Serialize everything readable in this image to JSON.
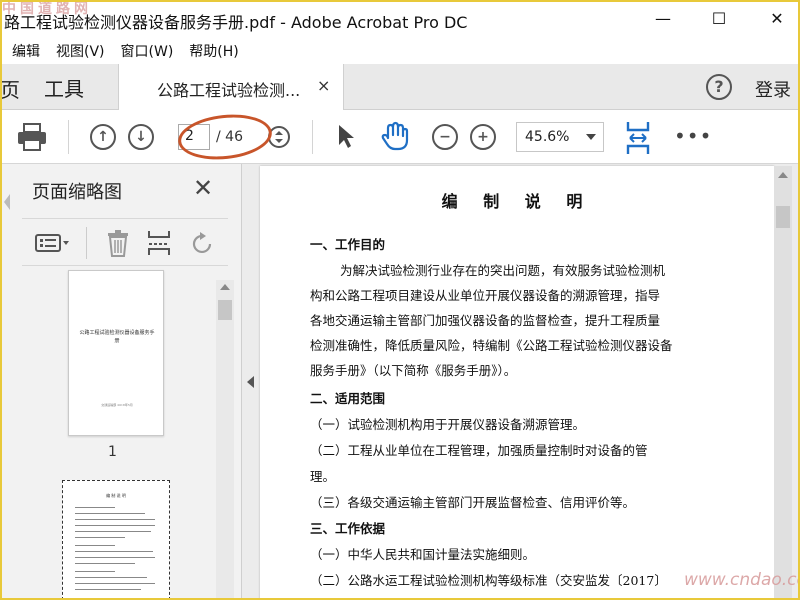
{
  "window": {
    "title": "路工程试验检测仪器设备服务手册.pdf - Adobe Acrobat Pro DC",
    "watermark_top": "中国道路网",
    "minimize": "—",
    "maximize": "☐",
    "close": "✕"
  },
  "menu": [
    "编辑",
    "视图(V)",
    "窗口(W)",
    "帮助(H)"
  ],
  "tabs": {
    "home_partial": "页",
    "tools": "工具",
    "document": "公路工程试验检测...",
    "close": "×",
    "help": "?",
    "login": "登录"
  },
  "toolbar": {
    "current_page": "2",
    "total_pages": "/ 46",
    "zoom": "45.6%",
    "more": "•••"
  },
  "sidepanel": {
    "title": "页面缩略图",
    "close": "✕",
    "thumb1_title": "公路工程试验检测仪器设备服务手册",
    "thumb1_footer": "交通运输部 2018年5月",
    "thumb1_number": "1",
    "thumb2_title": "编 制 说 明"
  },
  "document": {
    "title": "编 制 说 明",
    "lines": [
      {
        "text": "一、工作目的",
        "bold": true,
        "indent": false
      },
      {
        "text": "为解决试验检测行业存在的突出问题，有效服务试验检测机",
        "bold": false,
        "indent": true
      },
      {
        "text": "构和公路工程项目建设从业单位开展仪器设备的溯源管理，指导",
        "bold": false,
        "indent": false
      },
      {
        "text": "各地交通运输主管部门加强仪器设备的监督检查，提升工程质量",
        "bold": false,
        "indent": false
      },
      {
        "text": "检测准确性，降低质量风险，特编制《公路工程试验检测仪器设备",
        "bold": false,
        "indent": false
      },
      {
        "text": "服务手册》（以下简称《服务手册》）。",
        "bold": false,
        "indent": false
      },
      {
        "text": "二、适用范围",
        "bold": true,
        "indent": false
      },
      {
        "text": "（一）试验检测机构用于开展仪器设备溯源管理。",
        "bold": false,
        "indent": false
      },
      {
        "text": "（二）工程从业单位在工程管理，加强质量控制时对设备的管",
        "bold": false,
        "indent": false
      },
      {
        "text": "理。",
        "bold": false,
        "indent": false
      },
      {
        "text": "（三）各级交通运输主管部门开展监督检查、信用评价等。",
        "bold": false,
        "indent": false
      },
      {
        "text": "三、工作依据",
        "bold": true,
        "indent": false
      },
      {
        "text": "（一）中华人民共和国计量法实施细则。",
        "bold": false,
        "indent": false
      },
      {
        "text": "（二）公路水运工程试验检测机构等级标准（交安监发〔2017〕",
        "bold": false,
        "indent": false
      }
    ]
  },
  "watermark_bottom": "www.cndao.com",
  "colors": {
    "accent_blue": "#1f6fc5",
    "annotation_red": "#c8552a",
    "frame_yellow": "#e8c93a"
  }
}
